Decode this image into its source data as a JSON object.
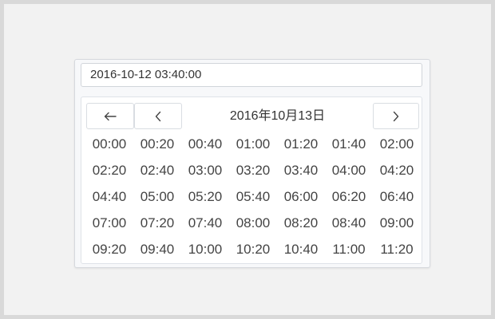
{
  "input": {
    "value": "2016-10-12 03:40:00"
  },
  "picker": {
    "header": {
      "title": "2016年10月13日",
      "back_icon": "arrow-left-icon",
      "prev_icon": "chevron-left-icon",
      "next_icon": "chevron-right-icon"
    },
    "times": [
      "00:00",
      "00:20",
      "00:40",
      "01:00",
      "01:20",
      "01:40",
      "02:00",
      "02:20",
      "02:40",
      "03:00",
      "03:20",
      "03:40",
      "04:00",
      "04:20",
      "04:40",
      "05:00",
      "05:20",
      "05:40",
      "06:00",
      "06:20",
      "06:40",
      "07:00",
      "07:20",
      "07:40",
      "08:00",
      "08:20",
      "08:40",
      "09:00",
      "09:20",
      "09:40",
      "10:00",
      "10:20",
      "10:40",
      "11:00",
      "11:20"
    ]
  }
}
